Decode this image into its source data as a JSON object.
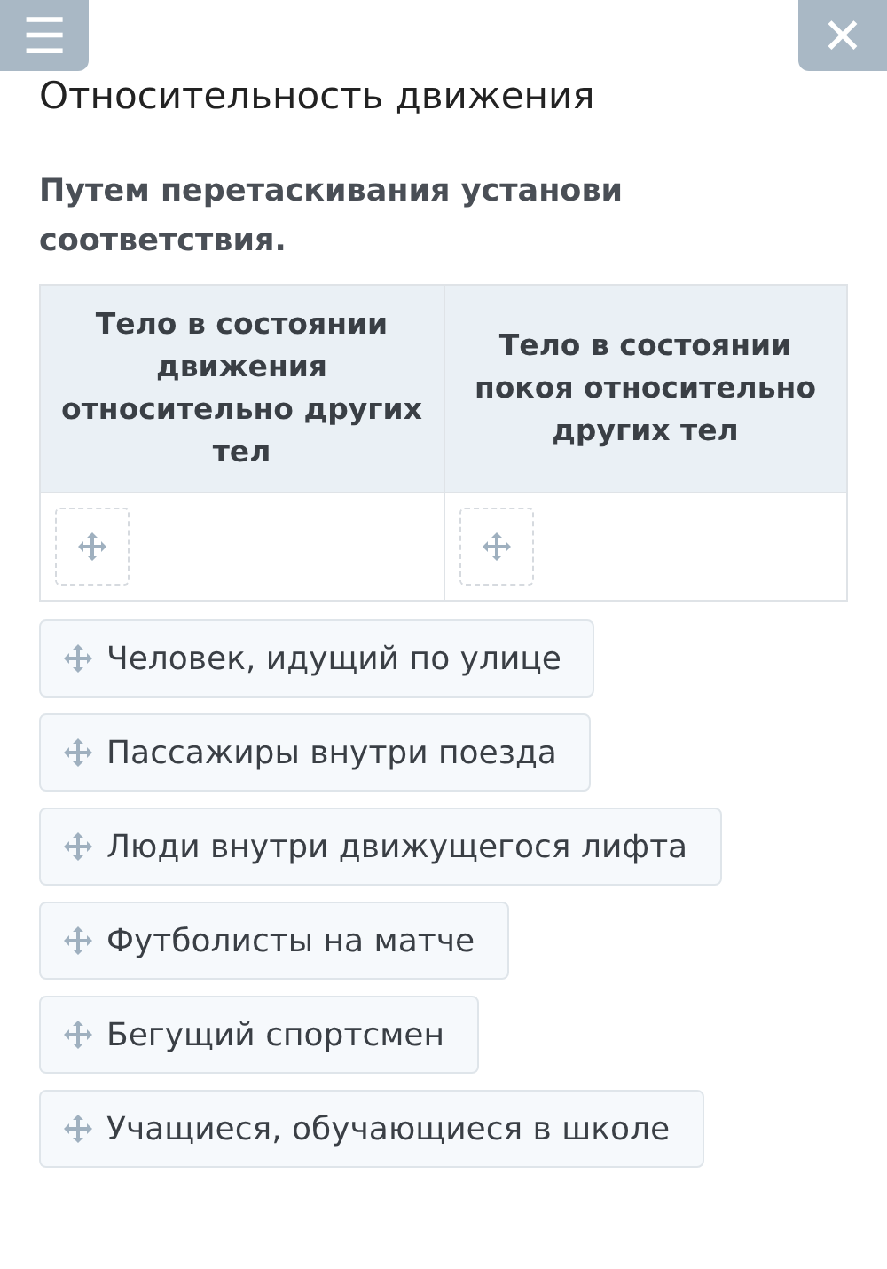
{
  "toolbar": {
    "menu_button": "☰",
    "close_button": "✕"
  },
  "title": "Относительность движения",
  "instruction": "Путем перетаскивания установи соответствия.",
  "table": {
    "columns": [
      "Тело в состоянии движения относительно других тел",
      "Тело в состоянии покоя относительно других тел"
    ]
  },
  "items": [
    "Человек, идущий по улице",
    "Пассажиры внутри поезда",
    "Люди внутри движущегося лифта",
    "Футболисты на матче",
    "Бегущий спортсмен",
    "Учащиеся, обучающиеся в школе"
  ]
}
